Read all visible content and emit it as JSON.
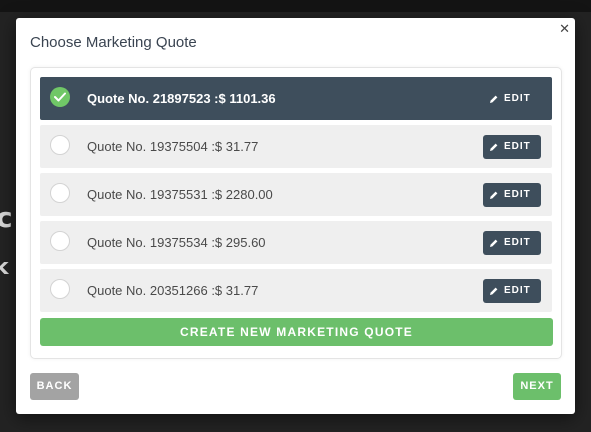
{
  "background": {
    "partial_text_1": "c",
    "partial_text_2": "k"
  },
  "modal": {
    "title": "Choose Marketing Quote",
    "close_icon": "close-icon",
    "quotes": [
      {
        "label": "Quote No. 21897523 :$ 1101.36",
        "selected": true,
        "edit_label": "EDIT"
      },
      {
        "label": "Quote No. 19375504 :$ 31.77",
        "selected": false,
        "edit_label": "EDIT"
      },
      {
        "label": "Quote No. 19375531 :$ 2280.00",
        "selected": false,
        "edit_label": "EDIT"
      },
      {
        "label": "Quote No. 19375534 :$ 295.60",
        "selected": false,
        "edit_label": "EDIT"
      },
      {
        "label": "Quote No. 20351266 :$ 31.77",
        "selected": false,
        "edit_label": "EDIT"
      }
    ],
    "create_label": "CREATE NEW MARKETING QUOTE",
    "back_label": "BACK",
    "next_label": "NEXT"
  },
  "colors": {
    "selected_row": "#3e4e5c",
    "accent_green": "#6cbf6b",
    "back_gray": "#a3a3a3"
  }
}
